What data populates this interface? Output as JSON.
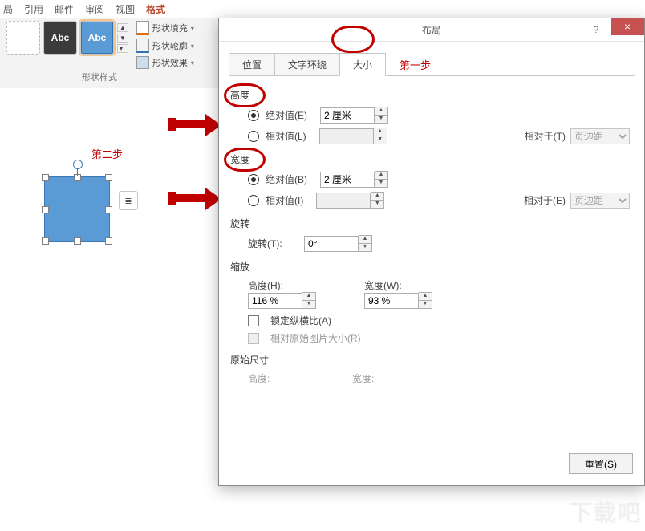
{
  "ribbon": {
    "tabs": [
      "局",
      "引用",
      "邮件",
      "审阅",
      "视图",
      "格式"
    ],
    "active_tab": 5,
    "abc": "Abc",
    "fill": "形状填充",
    "outline": "形状轮廓",
    "effects": "形状效果",
    "group_label": "形状样式"
  },
  "annotations": {
    "step1": "第一步",
    "step2": "第二步"
  },
  "dialog": {
    "title": "布局",
    "help": "?",
    "close": "×",
    "tabs": {
      "pos": "位置",
      "wrap": "文字环绕",
      "size": "大小",
      "active": 2
    },
    "height": {
      "title": "高度",
      "abs_label": "绝对值(E)",
      "abs_value": "2 厘米",
      "rel_label": "相对值(L)",
      "rel_value": "",
      "rel_to_label": "相对于(T)",
      "rel_to_value": "页边距"
    },
    "width": {
      "title": "宽度",
      "abs_label": "绝对值(B)",
      "abs_value": "2 厘米",
      "rel_label": "相对值(I)",
      "rel_value": "",
      "rel_to_label": "相对于(E)",
      "rel_to_value": "页边距"
    },
    "rotation": {
      "title": "旋转",
      "label": "旋转(T):",
      "value": "0°"
    },
    "scale": {
      "title": "缩放",
      "h_label": "高度(H):",
      "h_value": "116 %",
      "w_label": "宽度(W):",
      "w_value": "93 %",
      "lock": "锁定纵横比(A)",
      "orig": "相对原始图片大小(R)"
    },
    "original": {
      "title": "原始尺寸",
      "h_label": "高度:",
      "w_label": "宽度:"
    },
    "reset": "重置(S)"
  },
  "watermark": "下载吧"
}
